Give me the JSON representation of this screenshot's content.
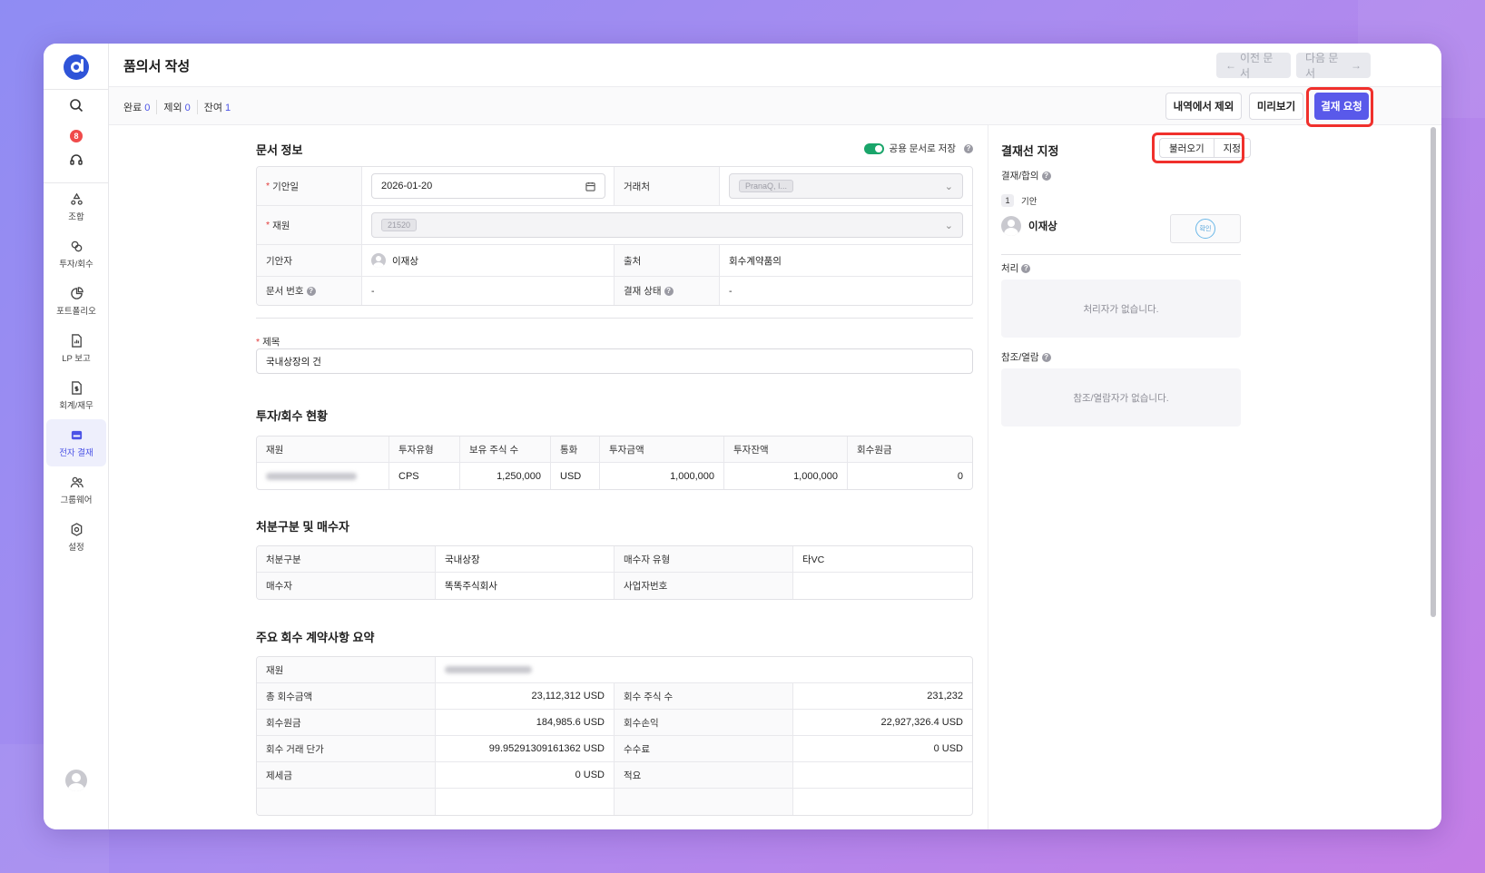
{
  "app": {
    "page_title": "품의서 작성",
    "prev_doc_label": "이전 문서",
    "next_doc_label": "다음 문서"
  },
  "sidebar": {
    "notification_count": "8",
    "items": [
      {
        "label": "조합",
        "icon": "cycle-icon"
      },
      {
        "label": "투자/회수",
        "icon": "links-icon"
      },
      {
        "label": "포트폴리오",
        "icon": "pie-chart-icon"
      },
      {
        "label": "LP 보고",
        "icon": "report-icon"
      },
      {
        "label": "회계/재무",
        "icon": "finance-doc-icon"
      },
      {
        "label": "전자 결재",
        "icon": "inbox-icon"
      },
      {
        "label": "그룹웨어",
        "icon": "people-icon"
      },
      {
        "label": "설정",
        "icon": "gear-icon"
      }
    ],
    "active_item": "전자 결재"
  },
  "subbar": {
    "done_label": "완료",
    "done_count": "0",
    "excluded_label": "제외",
    "excluded_count": "0",
    "remaining_label": "잔여",
    "remaining_count": "1",
    "exclude_button": "내역에서 제외",
    "preview_button": "미리보기",
    "request_button": "결재 요청"
  },
  "doc_info": {
    "title": "문서 정보",
    "shared_toggle_label": "공용 문서로 저장",
    "date_label": "기안일",
    "date_value": "2026-01-20",
    "partner_label": "거래처",
    "partner_chip": "PranaQ, I...",
    "fund_label": "재원",
    "fund_chip": "21520",
    "drafter_label": "기안자",
    "drafter_name": "이재상",
    "source_label": "출처",
    "source_value": "회수계약품의",
    "doc_no_label": "문서 번호",
    "doc_no_value": "-",
    "status_label": "결재 상태",
    "status_value": "-",
    "subject_label": "제목",
    "subject_value": "국내상장의 건"
  },
  "invest_status": {
    "title": "투자/회수 현황",
    "headers": [
      "재원",
      "투자유형",
      "보유 주식 수",
      "통화",
      "투자금액",
      "투자잔액",
      "회수원금"
    ],
    "row": [
      "",
      "CPS",
      "1,250,000",
      "USD",
      "1,000,000",
      "1,000,000",
      "0"
    ]
  },
  "disposal": {
    "title": "처분구분 및 매수자",
    "rows": [
      [
        "처분구분",
        "국내상장",
        "매수자 유형",
        "타VC"
      ],
      [
        "매수자",
        "똑똑주식회사",
        "사업자번호",
        ""
      ]
    ]
  },
  "contract_summary": {
    "title": "주요 회수 계약사항 요약",
    "fund_label": "재원",
    "rows": [
      [
        "총 회수금액",
        "23,112,312 USD",
        "회수 주식 수",
        "231,232"
      ],
      [
        "회수원금",
        "184,985.6 USD",
        "회수손익",
        "22,927,326.4 USD"
      ],
      [
        "회수 거래 단가",
        "99.95291309161362 USD",
        "수수료",
        "0 USD"
      ],
      [
        "제세금",
        "0 USD",
        "적요",
        ""
      ]
    ]
  },
  "approval_line": {
    "title": "결재선 지정",
    "load_button": "불러오기",
    "assign_button": "지정",
    "approval_label": "결재/합의",
    "step_number": "1",
    "step_label": "기안",
    "approver_name": "이재상",
    "stamp_text": "확인",
    "process_label": "처리",
    "process_empty": "처리자가 없습니다.",
    "reference_label": "참조/열람",
    "reference_empty": "참조/열람자가 없습니다."
  },
  "colors": {
    "accent": "#5959ea",
    "highlight": "#f0302c",
    "toggle_on": "#1aa56a",
    "badge": "#f04b4b"
  }
}
